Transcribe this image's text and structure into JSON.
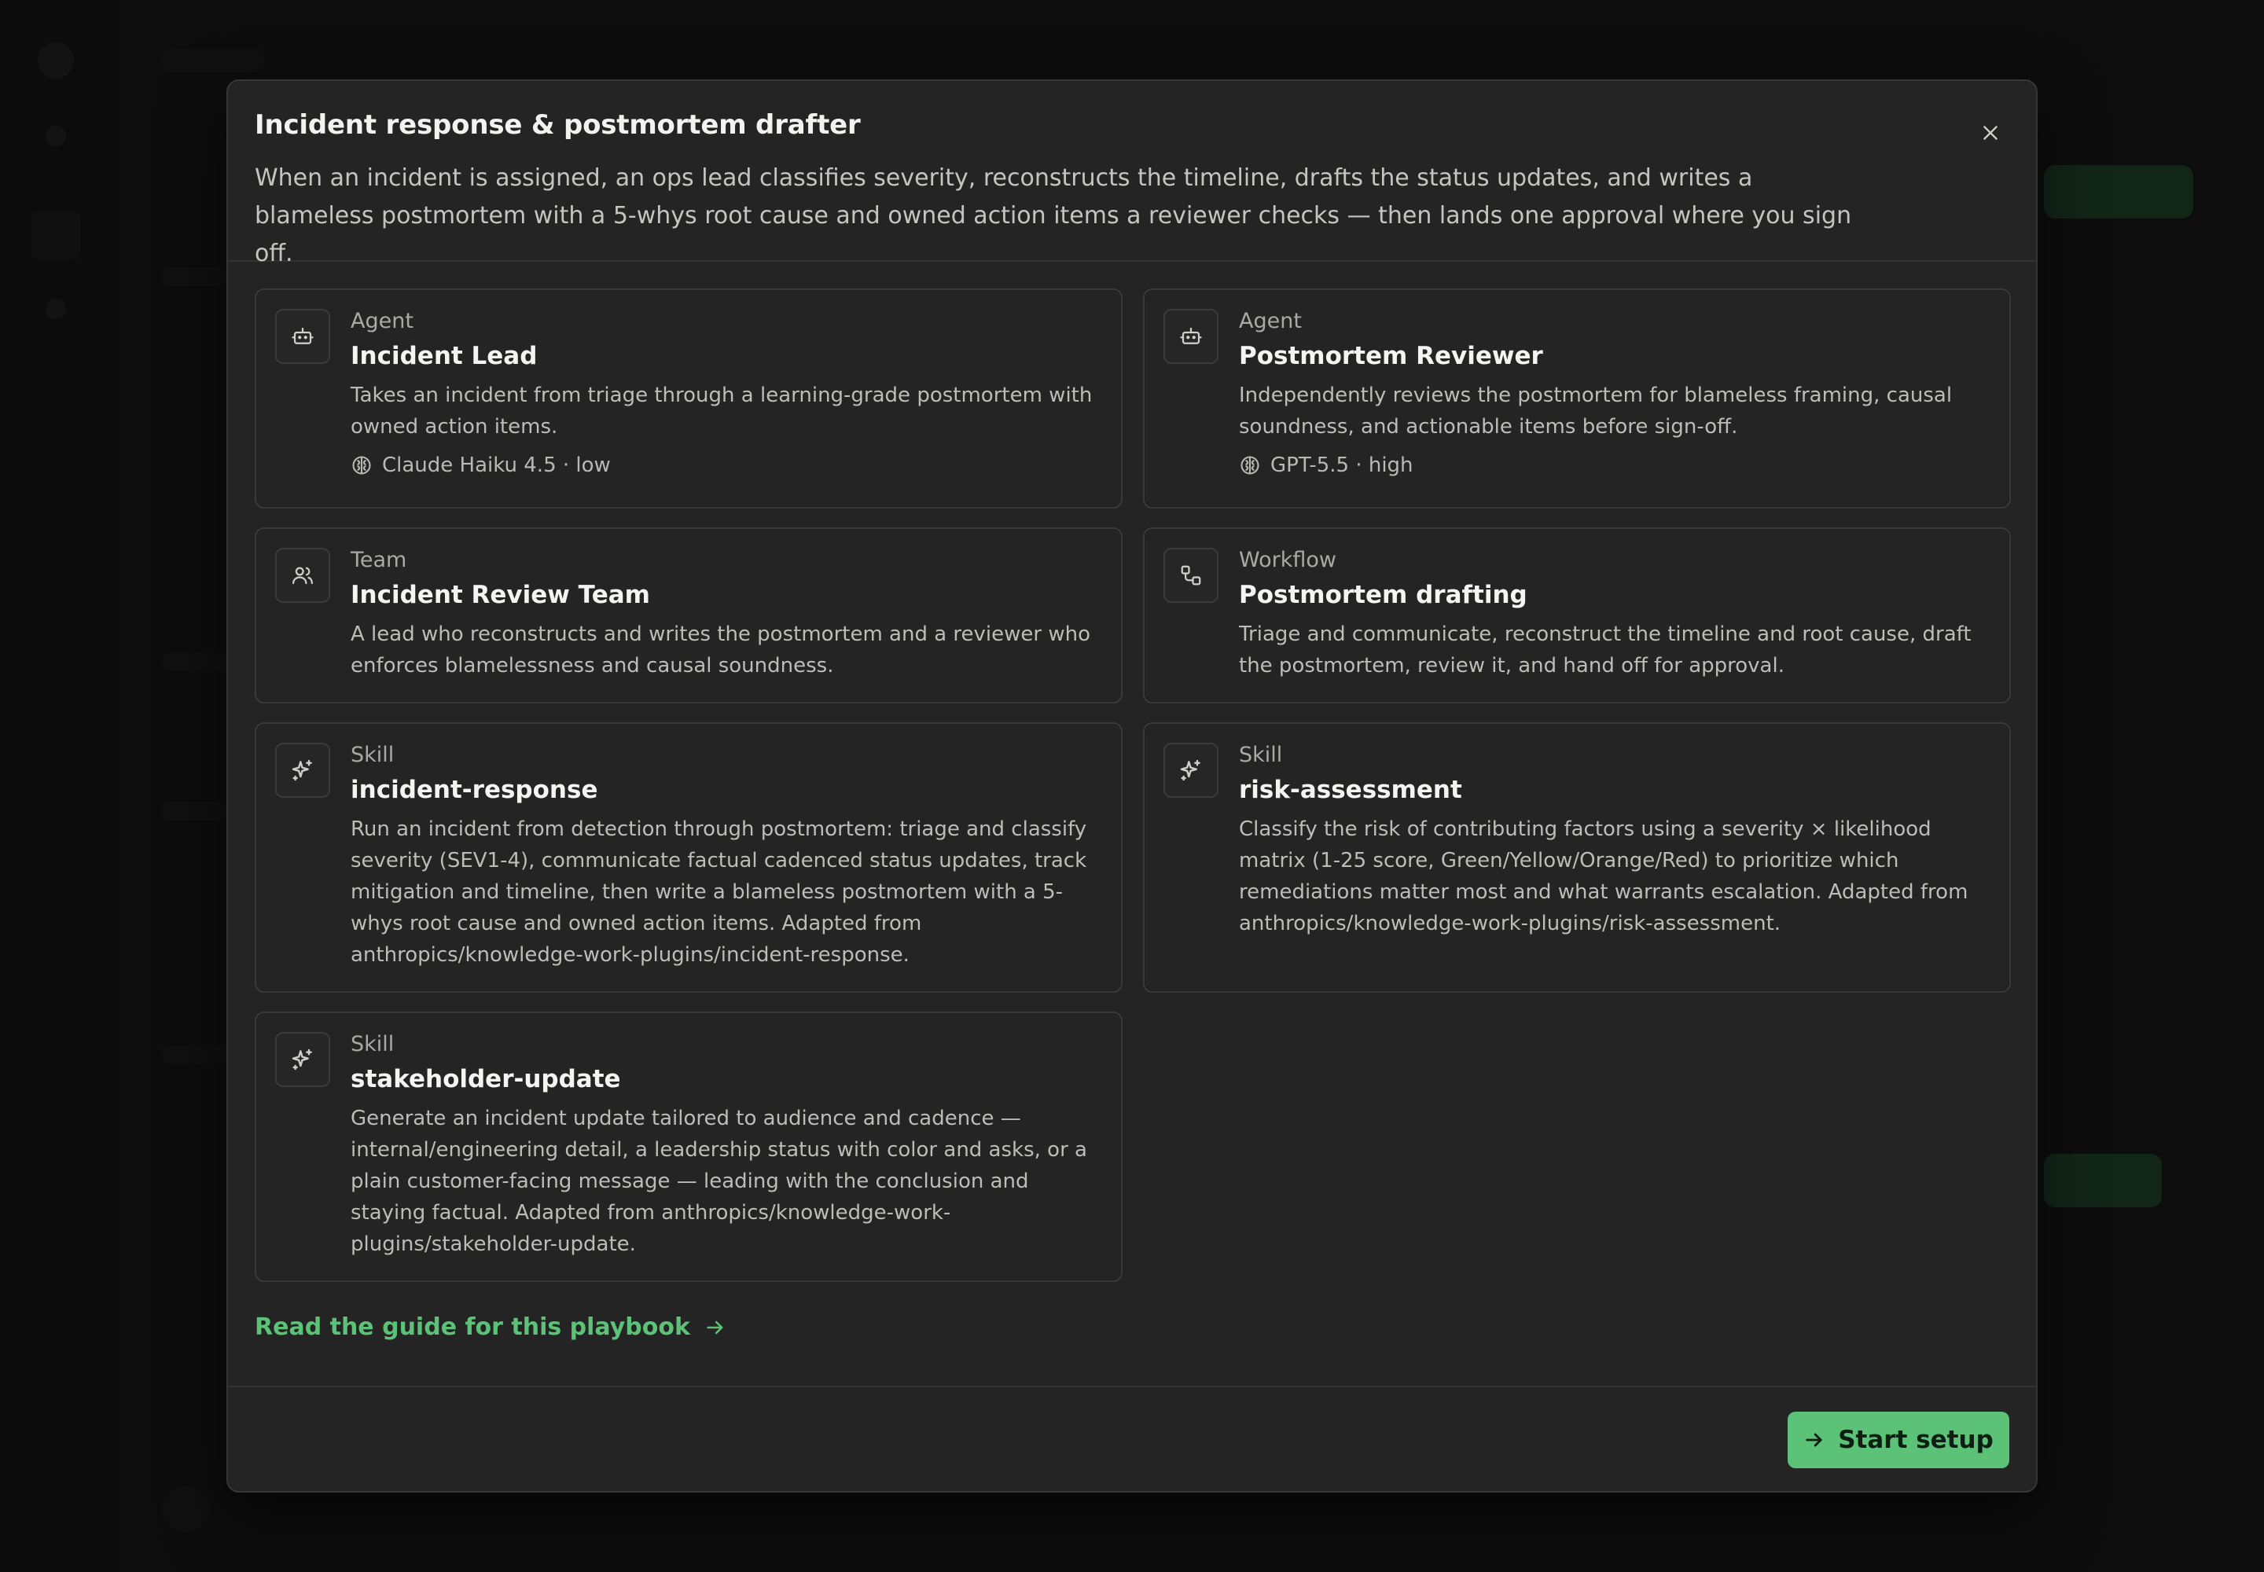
{
  "modal": {
    "title": "Incident response & postmortem drafter",
    "description": "When an incident is assigned, an ops lead classifies severity, reconstructs the timeline, drafts the status updates, and writes a blameless postmortem with a 5-whys root cause and owned action items a reviewer checks — then lands one approval where you sign off.",
    "close_icon": "close-icon"
  },
  "cards": [
    {
      "type": "Agent",
      "name": "Incident Lead",
      "description": "Takes an incident from triage through a learning-grade postmortem with owned action items.",
      "model": "Claude Haiku 4.5 · low",
      "icon": "robot-icon"
    },
    {
      "type": "Agent",
      "name": "Postmortem Reviewer",
      "description": "Independently reviews the postmortem for blameless framing, causal soundness, and actionable items before sign-off.",
      "model": "GPT-5.5 · high",
      "icon": "robot-icon"
    },
    {
      "type": "Team",
      "name": "Incident Review Team",
      "description": "A lead who reconstructs and writes the postmortem and a reviewer who enforces blamelessness and causal soundness.",
      "icon": "users-icon"
    },
    {
      "type": "Workflow",
      "name": "Postmortem drafting",
      "description": "Triage and communicate, reconstruct the timeline and root cause, draft the postmortem, review it, and hand off for approval.",
      "icon": "workflow-icon"
    },
    {
      "type": "Skill",
      "name": "incident-response",
      "description": "Run an incident from detection through postmortem: triage and classify severity (SEV1-4), communicate factual cadenced status updates, track mitigation and timeline, then write a blameless postmortem with a 5-whys root cause and owned action items. Adapted from anthropics/knowledge-work-plugins/incident-response.",
      "icon": "sparkle-icon"
    },
    {
      "type": "Skill",
      "name": "risk-assessment",
      "description": "Classify the risk of contributing factors using a severity × likelihood matrix (1-25 score, Green/Yellow/Orange/Red) to prioritize which remediations matter most and what warrants escalation. Adapted from anthropics/knowledge-work-plugins/risk-assessment.",
      "icon": "sparkle-icon"
    },
    {
      "type": "Skill",
      "name": "stakeholder-update",
      "description": "Generate an incident update tailored to audience and cadence — internal/engineering detail, a leadership status with color and asks, or a plain customer-facing message — leading with the conclusion and staying factual. Adapted from anthropics/knowledge-work-plugins/stakeholder-update.",
      "icon": "sparkle-icon"
    }
  ],
  "guide_link": "Read the guide for this playbook",
  "start_button": "Start setup",
  "colors": {
    "accent": "#5cc277",
    "modal_bg": "#242424",
    "border": "#3a3a3a"
  }
}
